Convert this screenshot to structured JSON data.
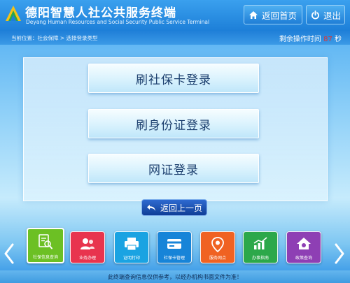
{
  "header": {
    "title_cn": "德阳智慧人社公共服务终端",
    "title_en": "Deyang Human Resources and Social Security Public Service Terminal",
    "home_label": "返回首页",
    "exit_label": "退出"
  },
  "crumb": {
    "text": "当前位置：社会保障 > 选择登录类型"
  },
  "timer": {
    "prefix": "剩余操作时间",
    "seconds": "87",
    "suffix": "秒"
  },
  "options": [
    {
      "label": "刷社保卡登录"
    },
    {
      "label": "刷身份证登录"
    },
    {
      "label": "网证登录"
    }
  ],
  "back": {
    "label": "返回上一页"
  },
  "dock": [
    {
      "label": "社保信息查询",
      "color": "#6cc024",
      "icon": "document-search-icon"
    },
    {
      "label": "业务办理",
      "color": "#e8344e",
      "icon": "users-icon"
    },
    {
      "label": "证明打印",
      "color": "#1aa3e2",
      "icon": "printer-icon"
    },
    {
      "label": "社保卡管理",
      "color": "#1784d8",
      "icon": "card-icon"
    },
    {
      "label": "服务网点",
      "color": "#f06222",
      "icon": "location-pin-icon"
    },
    {
      "label": "办事指南",
      "color": "#2ca84a",
      "icon": "chart-icon"
    },
    {
      "label": "政策查询",
      "color": "#8e3fb4",
      "icon": "house-icon"
    }
  ],
  "footer": {
    "notice": "此终端查询信息仅供参考，以经办机构书面文件为准！"
  },
  "colors": {
    "accent": "#1d7fd8",
    "timer_seconds": "#e8322c",
    "option_text": "#1c3f6e"
  }
}
